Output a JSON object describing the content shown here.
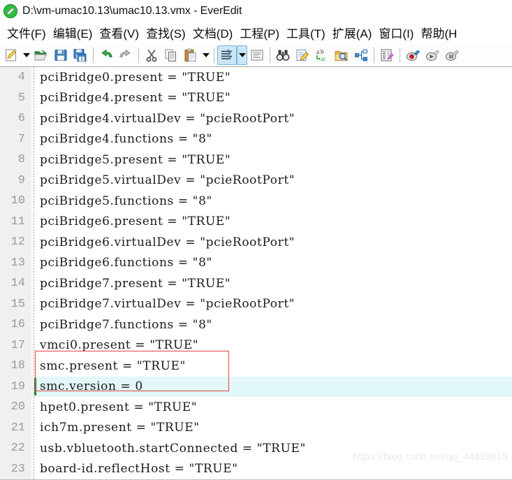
{
  "window": {
    "title": "D:\\vm-umac10.13\\umac10.13.vmx - EverEdit",
    "app_icon": "green-pencil-icon"
  },
  "menubar": {
    "items": [
      {
        "label": "文件(F)",
        "name": "file"
      },
      {
        "label": "编辑(E)",
        "name": "edit"
      },
      {
        "label": "查看(V)",
        "name": "view"
      },
      {
        "label": "查找(S)",
        "name": "search"
      },
      {
        "label": "文档(D)",
        "name": "document"
      },
      {
        "label": "工程(P)",
        "name": "project"
      },
      {
        "label": "工具(T)",
        "name": "tools"
      },
      {
        "label": "扩展(A)",
        "name": "extensions"
      },
      {
        "label": "窗口(I)",
        "name": "window"
      },
      {
        "label": "帮助(H",
        "name": "help"
      }
    ]
  },
  "toolbar": {
    "items": [
      {
        "type": "button",
        "icon": "new-file-icon",
        "name": "new-file"
      },
      {
        "type": "arrow",
        "icon": "chevron-down-icon",
        "name": "new-file-dropdown"
      },
      {
        "type": "button",
        "icon": "open-folder-icon",
        "name": "open-file"
      },
      {
        "type": "button",
        "icon": "save-icon",
        "name": "save-file"
      },
      {
        "type": "button",
        "icon": "save-all-icon",
        "name": "save-all-files"
      },
      {
        "type": "sep"
      },
      {
        "type": "button",
        "icon": "undo-icon",
        "name": "undo"
      },
      {
        "type": "button",
        "icon": "redo-icon",
        "name": "redo"
      },
      {
        "type": "sep"
      },
      {
        "type": "button",
        "icon": "scissors-cut-icon",
        "name": "cut"
      },
      {
        "type": "button",
        "icon": "copy-icon",
        "name": "copy"
      },
      {
        "type": "button",
        "icon": "clipboard-paste-icon",
        "name": "paste"
      },
      {
        "type": "arrow",
        "icon": "chevron-down-icon",
        "name": "paste-dropdown"
      },
      {
        "type": "sep"
      },
      {
        "type": "button",
        "icon": "line-wrap-icon",
        "name": "toggle-word-wrap",
        "active": true
      },
      {
        "type": "arrow",
        "icon": "chevron-down-icon",
        "name": "word-wrap-dropdown",
        "active": true
      },
      {
        "type": "button",
        "icon": "show-all-characters-icon",
        "name": "show-all-characters"
      },
      {
        "type": "sep"
      },
      {
        "type": "button",
        "icon": "binoculars-find-icon",
        "name": "find"
      },
      {
        "type": "button",
        "icon": "replace-pencil-icon",
        "name": "replace"
      },
      {
        "type": "button",
        "icon": "find-replace-abc-icon",
        "name": "find-replace-text"
      },
      {
        "type": "button",
        "icon": "find-in-files-folder-icon",
        "name": "find-in-files"
      },
      {
        "type": "button",
        "icon": "compare-files-icon",
        "name": "compare-files"
      },
      {
        "type": "sep"
      },
      {
        "type": "button",
        "icon": "hex-edit-icon",
        "name": "hex-editor"
      },
      {
        "type": "sep"
      },
      {
        "type": "button",
        "icon": "macro-record-icon",
        "name": "record-macro"
      },
      {
        "type": "button",
        "icon": "macro-play-icon",
        "name": "play-macro"
      },
      {
        "type": "button",
        "icon": "macro-pause-icon",
        "name": "pause-macro"
      }
    ]
  },
  "editor": {
    "current_line": 19,
    "lines": [
      {
        "num": "4",
        "text": "pciBridge0.present = \"TRUE\""
      },
      {
        "num": "5",
        "text": "pciBridge4.present = \"TRUE\""
      },
      {
        "num": "6",
        "text": "pciBridge4.virtualDev = \"pcieRootPort\""
      },
      {
        "num": "7",
        "text": "pciBridge4.functions = \"8\""
      },
      {
        "num": "8",
        "text": "pciBridge5.present = \"TRUE\""
      },
      {
        "num": "9",
        "text": "pciBridge5.virtualDev = \"pcieRootPort\""
      },
      {
        "num": "10",
        "text": "pciBridge5.functions = \"8\""
      },
      {
        "num": "11",
        "text": "pciBridge6.present = \"TRUE\""
      },
      {
        "num": "12",
        "text": "pciBridge6.virtualDev = \"pcieRootPort\""
      },
      {
        "num": "13",
        "text": "pciBridge6.functions = \"8\""
      },
      {
        "num": "14",
        "text": "pciBridge7.present = \"TRUE\""
      },
      {
        "num": "15",
        "text": "pciBridge7.virtualDev = \"pcieRootPort\""
      },
      {
        "num": "16",
        "text": "pciBridge7.functions = \"8\""
      },
      {
        "num": "17",
        "text": "vmci0.present = \"TRUE\""
      },
      {
        "num": "18",
        "text": "smc.present = \"TRUE\""
      },
      {
        "num": "19",
        "text": "smc.version = 0"
      },
      {
        "num": "20",
        "text": "hpet0.present = \"TRUE\""
      },
      {
        "num": "21",
        "text": "ich7m.present = \"TRUE\""
      },
      {
        "num": "22",
        "text": "usb.vbluetooth.startConnected = \"TRUE\""
      },
      {
        "num": "23",
        "text": "board-id.reflectHost = \"TRUE\""
      }
    ]
  },
  "annotation": {
    "highlight_color": "#e8413c",
    "covers_lines": "18-19"
  },
  "watermark": {
    "text": "https://blog.csdn.net/qq_44839815"
  },
  "colors": {
    "gutter_bg": "#f0f0f0",
    "line_number": "#9a9a9a",
    "current_line_bg": "#e2f7f7",
    "toolbar_active": "#cce6f7",
    "cursor": "#2f7d32"
  }
}
